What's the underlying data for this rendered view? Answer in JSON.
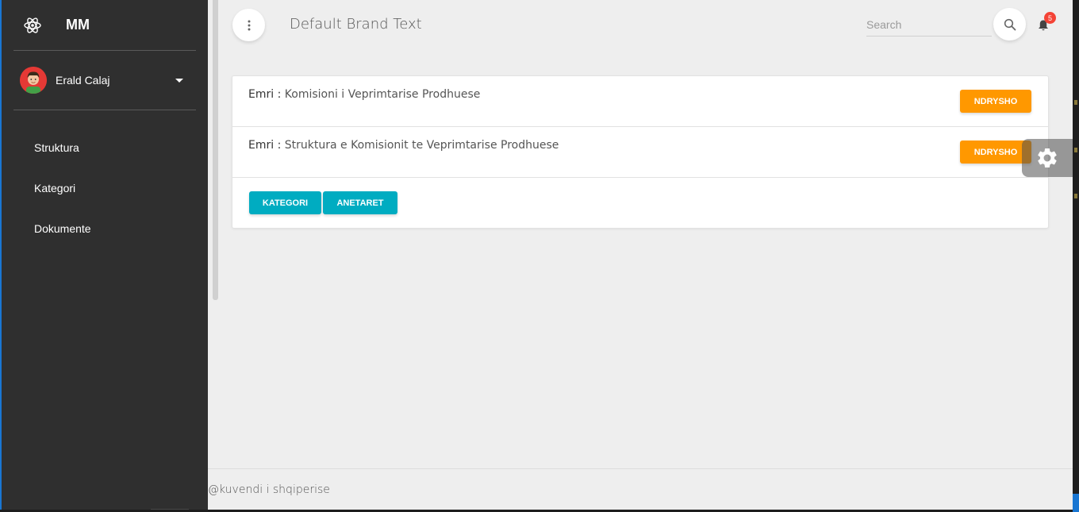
{
  "sidebar": {
    "brand": {
      "logo_icon": "atom-icon",
      "name": "MM"
    },
    "user": {
      "avatar_icon": "user-avatar",
      "name": "Erald Calaj"
    },
    "items": [
      {
        "label": "Struktura"
      },
      {
        "label": "Kategori"
      },
      {
        "label": "Dokumente"
      }
    ]
  },
  "header": {
    "brand_text": "Default Brand Text",
    "search_placeholder": "Search",
    "notification_count": "5"
  },
  "content": {
    "rows": [
      {
        "key": "Emri",
        "separator": " : ",
        "value": "Komisioni i Veprimtarise Prodhuese",
        "button_label": "NDRYSHO"
      },
      {
        "key": "Emri",
        "separator": " : ",
        "value": "Struktura e Komisionit te Veprimtarise Prodhuese",
        "button_label": "NDRYSHO"
      }
    ],
    "actions": [
      {
        "label": "KATEGORI"
      },
      {
        "label": "ANETARET"
      }
    ]
  },
  "footer": {
    "text": "@kuvendi i shqiperise"
  },
  "colors": {
    "sidebar_bg": "#2f2f2f",
    "main_bg": "#eeeeee",
    "primary_orange": "#ff9800",
    "primary_cyan": "#00acc1",
    "badge_red": "#f44336"
  }
}
